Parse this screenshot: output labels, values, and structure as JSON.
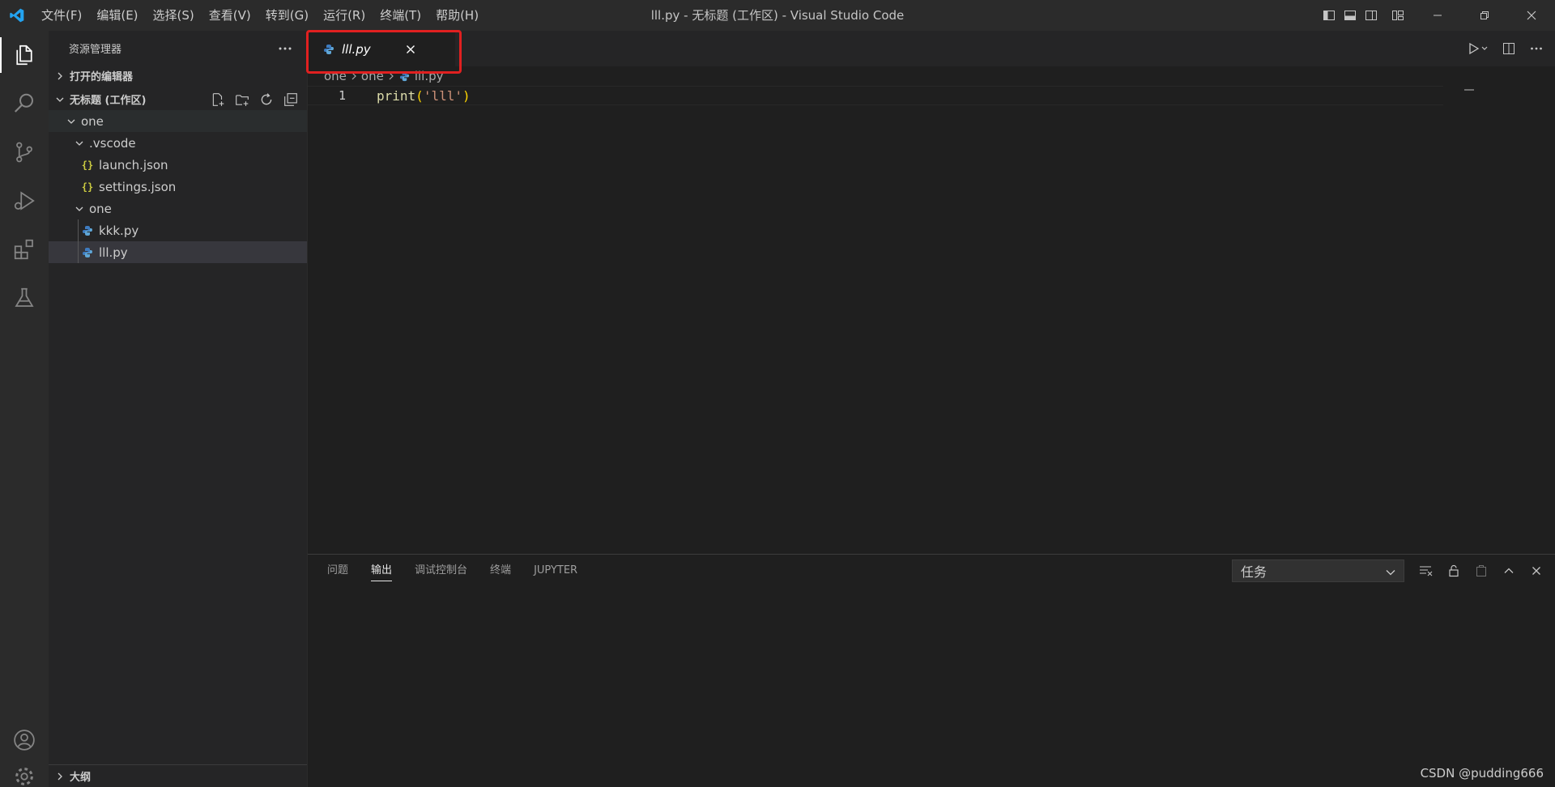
{
  "window": {
    "title": "lll.py - 无标题 (工作区) - Visual Studio Code",
    "accent": "#0078d4"
  },
  "menu": [
    "文件(F)",
    "编辑(E)",
    "选择(S)",
    "查看(V)",
    "转到(G)",
    "运行(R)",
    "终端(T)",
    "帮助(H)"
  ],
  "activity": {
    "items": [
      "explorer-icon",
      "search-icon",
      "source-control-icon",
      "run-debug-icon",
      "extensions-icon",
      "testing-icon"
    ],
    "bottom": [
      "account-icon",
      "settings-gear-icon"
    ]
  },
  "sidebar": {
    "title": "资源管理器",
    "open_editors": "打开的编辑器",
    "workspace": "无标题 (工作区)",
    "tree": {
      "root": "one",
      "vscode_folder": ".vscode",
      "launch": "launch.json",
      "settings": "settings.json",
      "sub_folder": "one",
      "kkk": "kkk.py",
      "lll": "lll.py"
    },
    "outline": "大纲",
    "json_glyph": "{}"
  },
  "editor": {
    "tab_label": "lll.py",
    "breadcrumb": [
      "one",
      "one",
      "lll.py"
    ],
    "line_number": "1",
    "code": {
      "fn": "print",
      "open": "(",
      "str": "'lll'",
      "close": ")"
    }
  },
  "panel": {
    "tabs": [
      "问题",
      "输出",
      "调试控制台",
      "终端",
      "JUPYTER"
    ],
    "active_tab": "输出",
    "select_value": "任务"
  },
  "watermark": "CSDN @pudding666"
}
